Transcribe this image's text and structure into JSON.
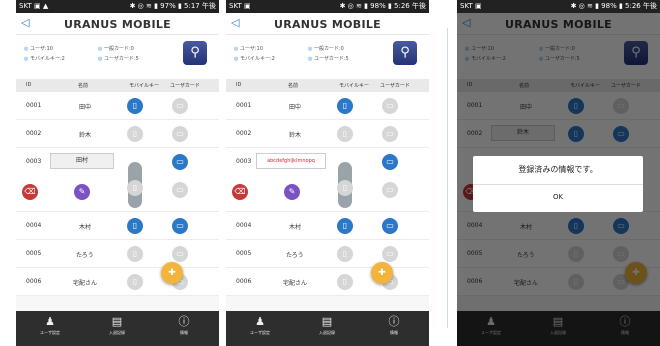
{
  "screens": [
    {
      "status_left": "SKT ▣ ▲",
      "status_right": "✱ ◎ ≋ ▮ 97% ▮ 5:17 午後"
    },
    {
      "status_left": "SKT ▣",
      "status_right": "✱ ◎ ≋ ▮ 98% ▮ 5:26 午後"
    },
    {
      "status_left": "SKT ▣",
      "status_right": "✱ ◎ ≋ ▮ 98% ▮ 5:26 午後"
    }
  ],
  "app": {
    "title": "URANUS MOBILE",
    "back": "◁",
    "stats": {
      "users": "ユーザ:10",
      "mobile_keys": "モバイルキー:2",
      "general_cards": "一般カード:0",
      "user_cards": "ユーザカード:5"
    },
    "columns": {
      "id": "ID",
      "name": "名前",
      "mobile_key": "モバイルキー",
      "user_card": "ユーザカード"
    },
    "rows": [
      {
        "id": "0001",
        "name": "田中"
      },
      {
        "id": "0002",
        "name": "鈴木"
      },
      {
        "id": "0003",
        "name": "田村"
      },
      {
        "id": "0004",
        "name": "木村"
      },
      {
        "id": "0005",
        "name": "たろう"
      },
      {
        "id": "0006",
        "name": "宅配さん"
      }
    ],
    "edit_value_screen2": "abcdefghijklmnopq",
    "tabs": {
      "user_settings": "ユーザ設定",
      "entry_log": "入退記録",
      "info": "情報"
    },
    "dialog": {
      "message": "登録済みの情報です。",
      "ok": "OK"
    }
  },
  "colors": {
    "accent": "#2b78c8",
    "fab": "#f2b43a",
    "tabbar": "#2e2e2e",
    "delete": "#c83838",
    "edit": "#7b52c1"
  },
  "icons": {
    "search": "search-icon",
    "mobile": "phone-icon",
    "card": "card-icon",
    "add_user": "add-user-icon",
    "users": "users-icon",
    "log": "clipboard-icon",
    "info": "info-icon",
    "delete": "trash-icon",
    "edit": "pencil-icon"
  }
}
